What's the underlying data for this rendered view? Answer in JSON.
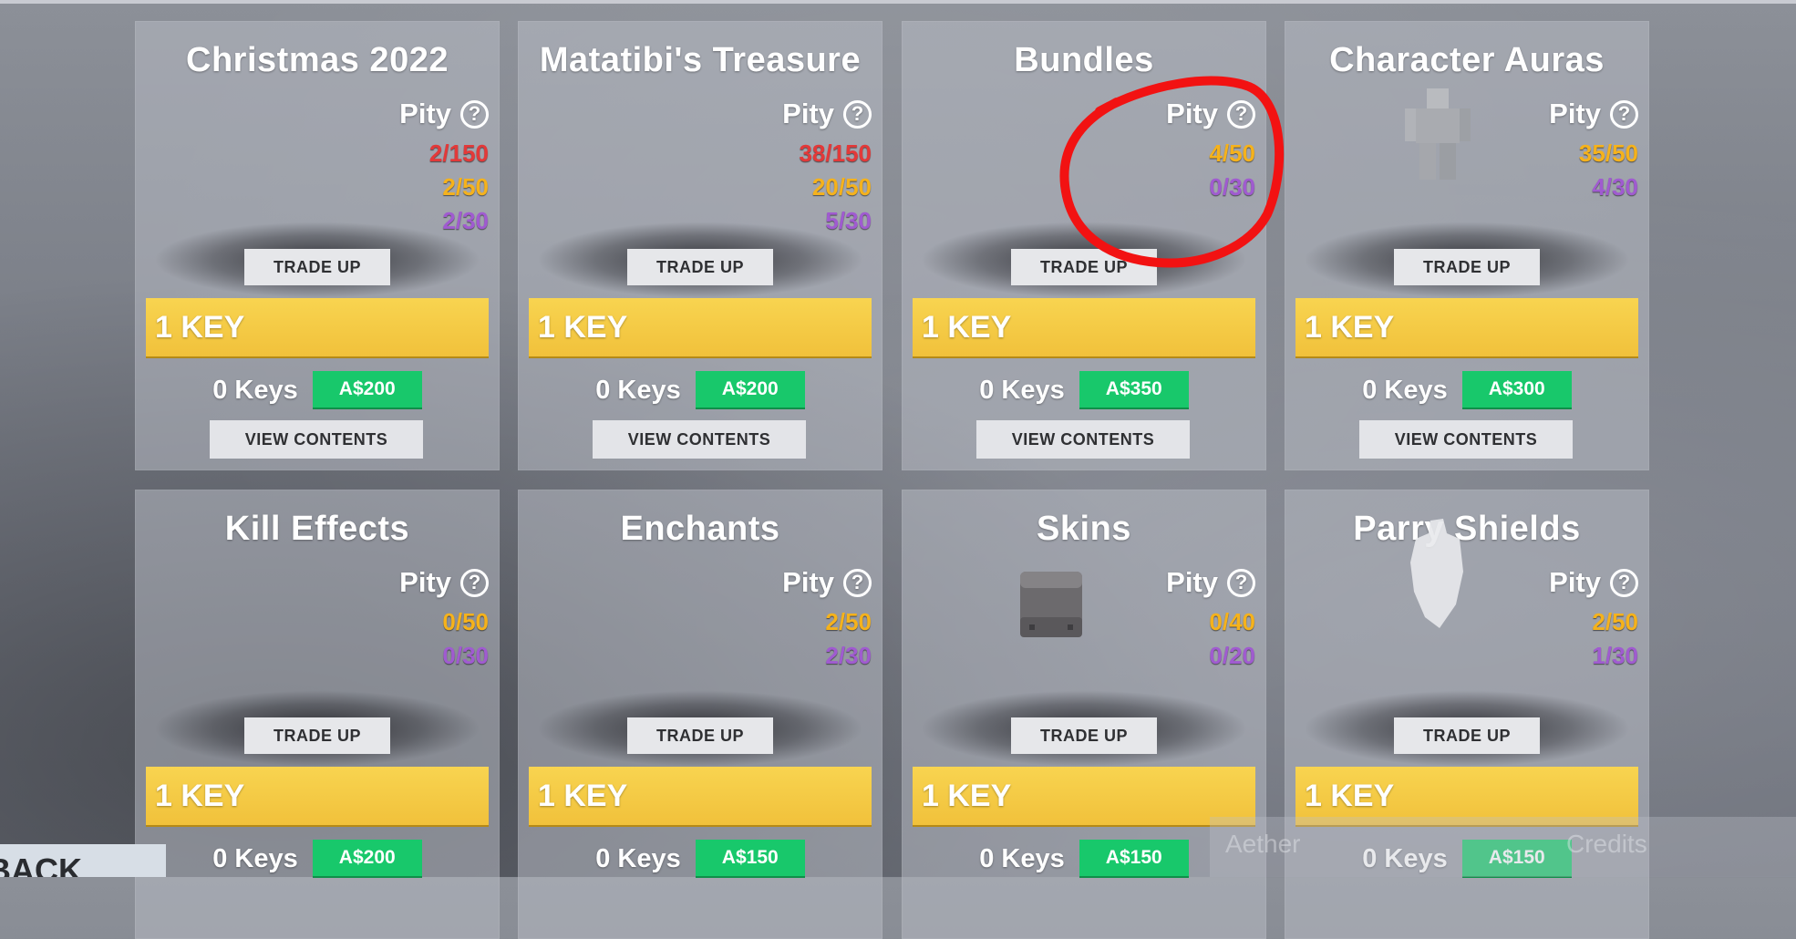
{
  "colors": {
    "rare": "#e33939",
    "legendary": "#f5b21c",
    "mythic": "#a05bd0",
    "key_bar": "#f3c63f",
    "price_button": "#18c86b",
    "annotation": "#f21212"
  },
  "cards": [
    {
      "title": "Christmas 2022",
      "pity_label": "Pity",
      "counters": [
        {
          "value": "2/150",
          "tone": "rare"
        },
        {
          "value": "2/50",
          "tone": "legendary"
        },
        {
          "value": "2/30",
          "tone": "mythic"
        }
      ],
      "trade_up": "TRADE UP",
      "key_label": "1 KEY",
      "keys_owned": "0 Keys",
      "price": "A$200",
      "view_contents": "VIEW CONTENTS"
    },
    {
      "title": "Matatibi's Treasure",
      "pity_label": "Pity",
      "counters": [
        {
          "value": "38/150",
          "tone": "rare"
        },
        {
          "value": "20/50",
          "tone": "legendary"
        },
        {
          "value": "5/30",
          "tone": "mythic"
        }
      ],
      "trade_up": "TRADE UP",
      "key_label": "1 KEY",
      "keys_owned": "0 Keys",
      "price": "A$200",
      "view_contents": "VIEW CONTENTS"
    },
    {
      "title": "Bundles",
      "pity_label": "Pity",
      "counters": [
        {
          "value": "4/50",
          "tone": "legendary"
        },
        {
          "value": "0/30",
          "tone": "mythic"
        }
      ],
      "trade_up": "TRADE UP",
      "key_label": "1 KEY",
      "keys_owned": "0 Keys",
      "price": "A$350",
      "view_contents": "VIEW CONTENTS"
    },
    {
      "title": "Character Auras",
      "pity_label": "Pity",
      "counters": [
        {
          "value": "35/50",
          "tone": "legendary"
        },
        {
          "value": "4/30",
          "tone": "mythic"
        }
      ],
      "trade_up": "TRADE UP",
      "key_label": "1 KEY",
      "keys_owned": "0 Keys",
      "price": "A$300",
      "view_contents": "VIEW CONTENTS"
    },
    {
      "title": "Kill Effects",
      "pity_label": "Pity",
      "counters": [
        {
          "value": "0/50",
          "tone": "legendary"
        },
        {
          "value": "0/30",
          "tone": "mythic"
        }
      ],
      "trade_up": "TRADE UP",
      "key_label": "1 KEY",
      "keys_owned": "0 Keys",
      "price": "A$200"
    },
    {
      "title": "Enchants",
      "pity_label": "Pity",
      "counters": [
        {
          "value": "2/50",
          "tone": "legendary"
        },
        {
          "value": "2/30",
          "tone": "mythic"
        }
      ],
      "trade_up": "TRADE UP",
      "key_label": "1 KEY",
      "keys_owned": "0 Keys",
      "price": "A$150"
    },
    {
      "title": "Skins",
      "pity_label": "Pity",
      "counters": [
        {
          "value": "0/40",
          "tone": "legendary"
        },
        {
          "value": "0/20",
          "tone": "mythic"
        }
      ],
      "trade_up": "TRADE UP",
      "key_label": "1 KEY",
      "keys_owned": "0 Keys",
      "price": "A$150"
    },
    {
      "title": "Parry Shields",
      "pity_label": "Pity",
      "counters": [
        {
          "value": "2/50",
          "tone": "legendary"
        },
        {
          "value": "1/30",
          "tone": "mythic"
        }
      ],
      "trade_up": "TRADE UP",
      "key_label": "1 KEY",
      "keys_owned": "0 Keys",
      "price": "A$150"
    }
  ],
  "footer": {
    "back_label": "BACK",
    "currency_left": "Aether",
    "currency_right": "Credits"
  }
}
